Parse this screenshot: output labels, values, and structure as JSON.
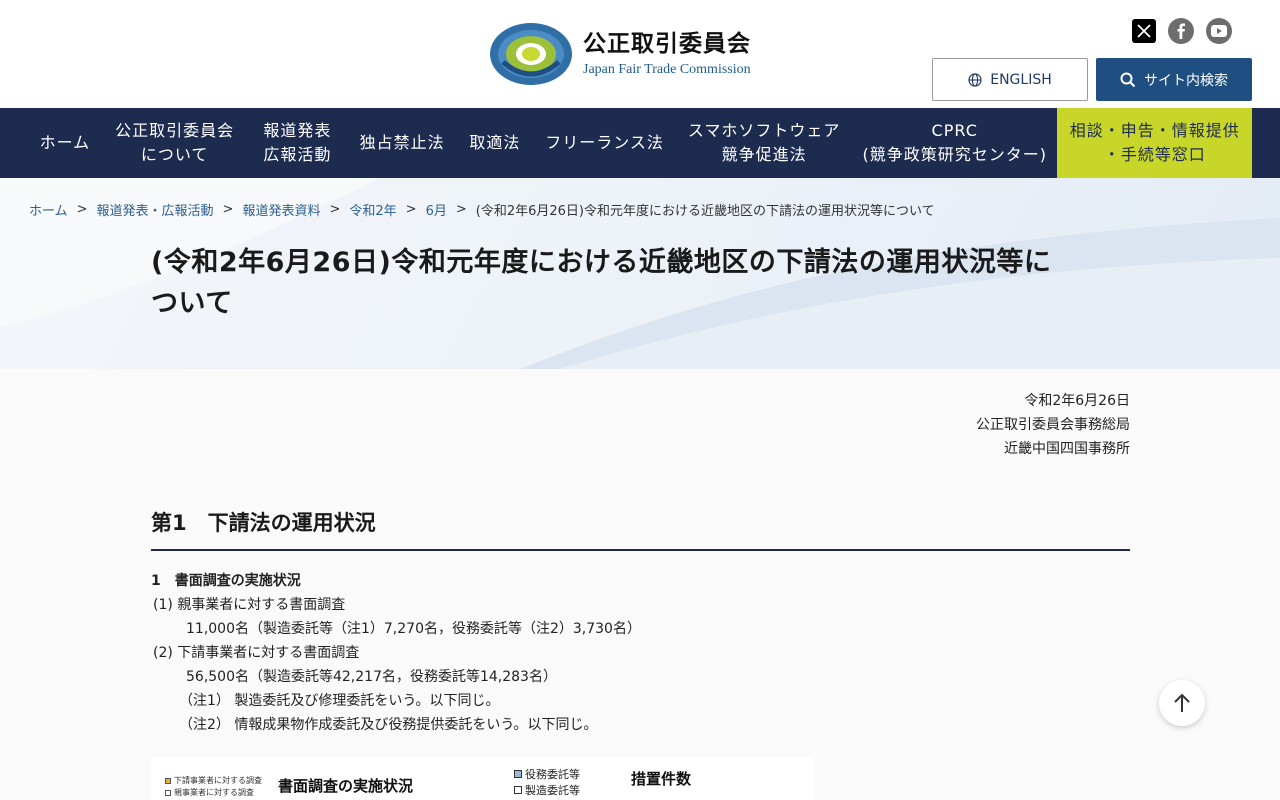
{
  "header": {
    "logo_ja": "公正取引委員会",
    "logo_en": "Japan Fair Trade Commission",
    "logo_ring_text": "JAPAN FAIR TRADE COMMISSION",
    "english_label": "ENGLISH",
    "search_label": "サイト内検索"
  },
  "nav": {
    "items": [
      {
        "line1": "ホーム",
        "line2": ""
      },
      {
        "line1": "公正取引委員会",
        "line2": "について"
      },
      {
        "line1": "報道発表",
        "line2": "広報活動"
      },
      {
        "line1": "独占禁止法",
        "line2": ""
      },
      {
        "line1": "取適法",
        "line2": ""
      },
      {
        "line1": "フリーランス法",
        "line2": ""
      },
      {
        "line1": "スマホソフトウェア",
        "line2": "競争促進法"
      },
      {
        "line1": "CPRC",
        "line2": "(競争政策研究センター)"
      },
      {
        "line1": "相談・申告・情報提供",
        "line2": "・手続等窓口"
      }
    ]
  },
  "breadcrumb": {
    "items": [
      "ホーム",
      "報道発表・広報活動",
      "報道発表資料",
      "令和2年",
      "6月"
    ],
    "current": "(令和2年6月26日)令和元年度における近畿地区の下請法の運用状況等について",
    "separator": ">"
  },
  "page": {
    "title_line1": "(令和2年6月26日)令和元年度における近畿地区の下請法の運用状況等に",
    "title_line2": "ついて"
  },
  "meta": {
    "date": "令和2年6月26日",
    "org": "公正取引委員会事務総局",
    "office": "近畿中国四国事務所"
  },
  "content": {
    "section_heading": "第1　下請法の運用状況",
    "h1": "1　書面調査の実施状況",
    "p1": "(1) 親事業者に対する書面調査",
    "p1_detail": "11,000名（製造委託等（注1）7,270名，役務委託等（注2）3,730名）",
    "p2": "(2) 下請事業者に対する書面調査",
    "p2_detail": "56,500名（製造委託等42,217名，役務委託等14,283名）",
    "note1": "（注1） 製造委託及び修理委託をいう。以下同じ。",
    "note2": "（注2） 情報成果物作成委託及び役務提供委託をいう。以下同じ。"
  },
  "figure": {
    "legend_a": "下請事業者に対する調査",
    "legend_b": "親事業者に対する調査",
    "title": "書面調査の実施状況",
    "legend_c": "役務委託等",
    "legend_d": "製造委託等",
    "right_title": "措置件数"
  },
  "colors": {
    "navy": "#1d2b4f",
    "accent": "#c8d62a",
    "link": "#2b5f92",
    "search_btn": "#1f4f80"
  }
}
